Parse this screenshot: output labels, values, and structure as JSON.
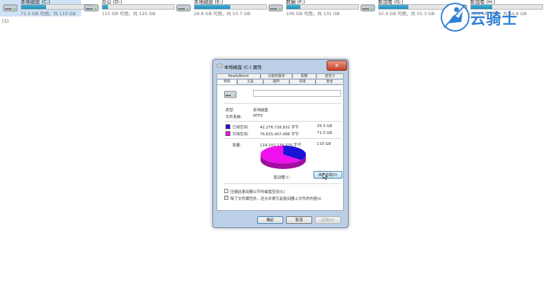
{
  "drives": [
    {
      "name": "本地磁盘 (C:)",
      "stats": "71.5 GB 可用，共 110 GB",
      "used_fraction": 0.35,
      "selected": true
    },
    {
      "name": "办公 (D:)",
      "stats": "115 GB 可用，共 125 GB",
      "used_fraction": 0.08,
      "selected": false
    },
    {
      "name": "本地磁盘 (E:)",
      "stats": "26.8 GB 可用，共 53.7 GB",
      "used_fraction": 0.5,
      "selected": false
    },
    {
      "name": "数据 (F:)",
      "stats": "106 GB 可用，共 131 GB",
      "used_fraction": 0.19,
      "selected": false
    },
    {
      "name": "新加卷 (G:)",
      "stats": "32.4 GB 可用，共 55.3 GB",
      "used_fraction": 0.41,
      "selected": false
    },
    {
      "name": "新加卷 (H:)",
      "stats": "38.3 GB 可用，共 54.6 GB",
      "used_fraction": 0.3,
      "selected": false
    }
  ],
  "count_label": "(1)",
  "watermark": {
    "text": "云骑士",
    "color": "#2f7fd6"
  },
  "dialog": {
    "title": "本地磁盘 (C:) 属性",
    "close_label": "✕",
    "tabs_row1": [
      "ReadyBoost",
      "以前的版本",
      "配额",
      "自定义"
    ],
    "tabs_row2": [
      "常规",
      "工具",
      "硬件",
      "共享",
      "安全"
    ],
    "active_tab": "常规",
    "drive_name_value": "",
    "type_label": "类型:",
    "type_value": "本地磁盘",
    "fs_label": "文件系统:",
    "fs_value": "NTFS",
    "used": {
      "label": "已用空间:",
      "bytes": "42,276,728,832 字节",
      "size": "39.3 GB",
      "color": "#1a14d8"
    },
    "free": {
      "label": "可用空间:",
      "bytes": "76,825,407,488 字节",
      "size": "71.5 GB",
      "color": "#ee11ee"
    },
    "capacity": {
      "label": "容量:",
      "bytes": "119,102,136,320 字节",
      "size": "110 GB"
    },
    "drive_letter_label": "驱动器 C:",
    "cleanup_label": "磁盘清理(D)",
    "compress_label": "压缩此驱动器以节约磁盘空间(C)",
    "compress_checked": false,
    "index_label": "除了文件属性外，还允许索引此驱动器上文件的内容(I)",
    "index_checked": true,
    "ok_label": "确定",
    "cancel_label": "取消",
    "apply_label": "应用(A)"
  }
}
